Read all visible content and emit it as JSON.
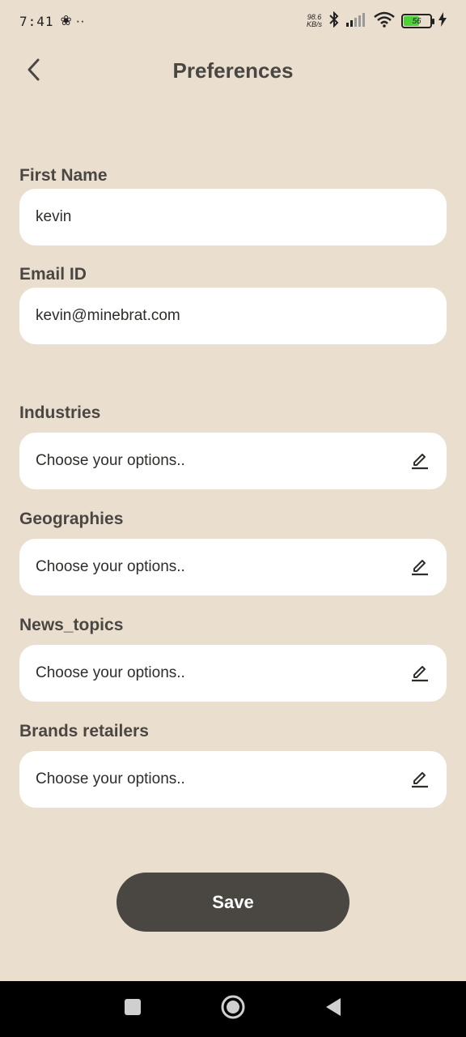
{
  "status_bar": {
    "time": "7:41",
    "extra_icons": "❀ ··",
    "net_speed_value": "98.6",
    "net_speed_unit": "KB/s",
    "battery_level": "56"
  },
  "header": {
    "title": "Preferences"
  },
  "form": {
    "first_name": {
      "label": "First Name",
      "value": "kevin"
    },
    "email": {
      "label": "Email ID",
      "value": "kevin@minebrat.com"
    },
    "industries": {
      "label": "Industries",
      "placeholder": "Choose your options.."
    },
    "geographies": {
      "label": "Geographies",
      "placeholder": "Choose your options.."
    },
    "news_topics": {
      "label": "News_topics",
      "placeholder": "Choose your options.."
    },
    "brands_retailers": {
      "label": "Brands retailers",
      "placeholder": "Choose your options.."
    }
  },
  "actions": {
    "save_label": "Save"
  },
  "colors": {
    "background": "#eadfcf",
    "field_bg": "#ffffff",
    "primary_text": "#4a4743",
    "button_bg": "#4a4743",
    "button_text": "#ffffff"
  }
}
